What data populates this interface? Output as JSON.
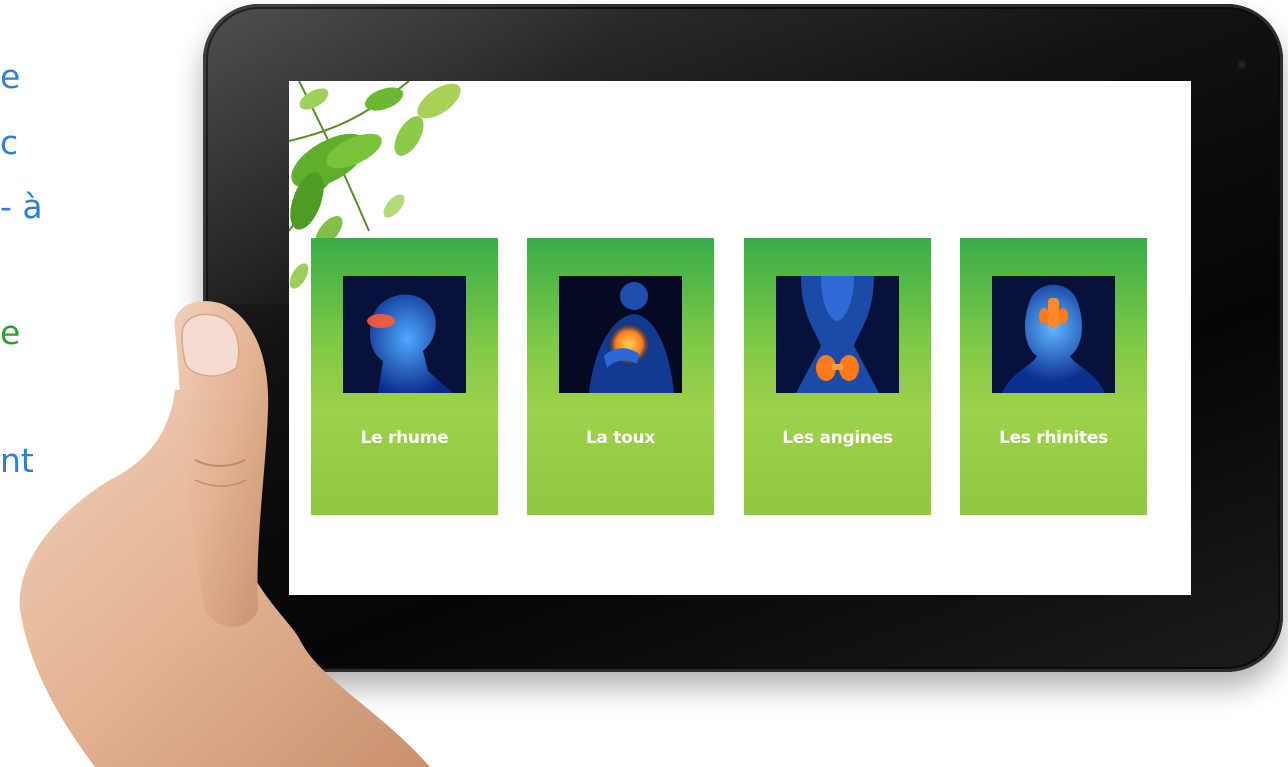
{
  "side_text": {
    "fragments": [
      "e",
      "c",
      "- à",
      "e",
      "nt"
    ],
    "colors": {
      "blue": "#2f7fd6",
      "green": "#2aa12e"
    }
  },
  "tablet": {
    "bezel_color": "#0b0b0b",
    "camera_icon": "camera-icon"
  },
  "screen": {
    "decoration": "leaves-icon",
    "cards": [
      {
        "label": "Le rhume",
        "icon": "head-nose-anatomy-icon"
      },
      {
        "label": "La toux",
        "icon": "chest-cough-anatomy-icon"
      },
      {
        "label": "Les angines",
        "icon": "throat-anatomy-icon"
      },
      {
        "label": "Les rhinites",
        "icon": "sinus-anatomy-icon"
      }
    ],
    "card_gradient": [
      "#37ad47",
      "#9ed14a"
    ]
  }
}
